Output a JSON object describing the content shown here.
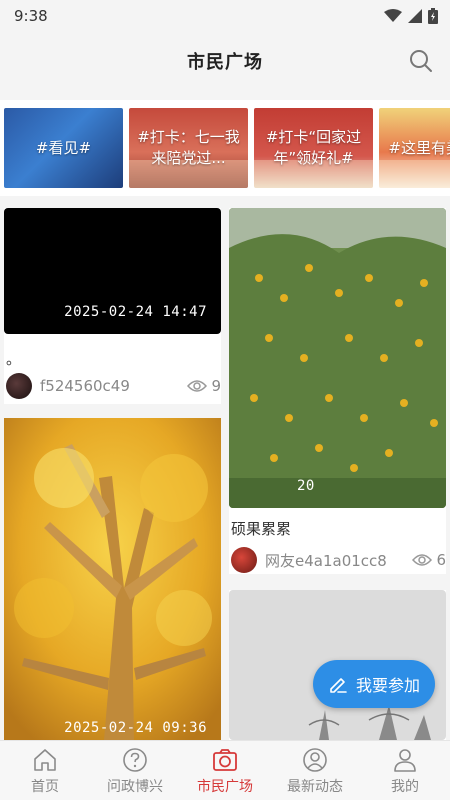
{
  "status_bar": {
    "time": "9:38",
    "icons": [
      "wifi-icon",
      "signal-icon",
      "battery-icon"
    ]
  },
  "header": {
    "title": "市民广场",
    "search_icon": "search-icon"
  },
  "topics": [
    {
      "label": "#看见#"
    },
    {
      "label": "#打卡：七一我来陪党过..."
    },
    {
      "label": "#打卡“回家过年”领好礼#"
    },
    {
      "label": "#这里有美食#"
    }
  ],
  "feed": {
    "left": [
      {
        "type": "video",
        "time": "2025-02-24 14:47",
        "title": "。",
        "author": "f524560c49",
        "views": "9"
      },
      {
        "type": "image",
        "time": "2025-02-24 09:36"
      }
    ],
    "right": [
      {
        "type": "image",
        "time": "20",
        "title": "硕果累累",
        "author": "网友e4a1a01cc8",
        "views": "6"
      },
      {
        "type": "image"
      }
    ]
  },
  "fab": {
    "label": "我要参加",
    "icon": "edit-icon"
  },
  "tabbar": {
    "items": [
      {
        "label": "首页",
        "icon": "home-icon"
      },
      {
        "label": "问政博兴",
        "icon": "question-icon"
      },
      {
        "label": "市民广场",
        "icon": "camera-icon",
        "active": true
      },
      {
        "label": "最新动态",
        "icon": "news-icon"
      },
      {
        "label": "我的",
        "icon": "user-icon"
      }
    ]
  },
  "colors": {
    "accent": "#d63a3a",
    "fab": "#2d8ee6",
    "muted": "#888888"
  }
}
